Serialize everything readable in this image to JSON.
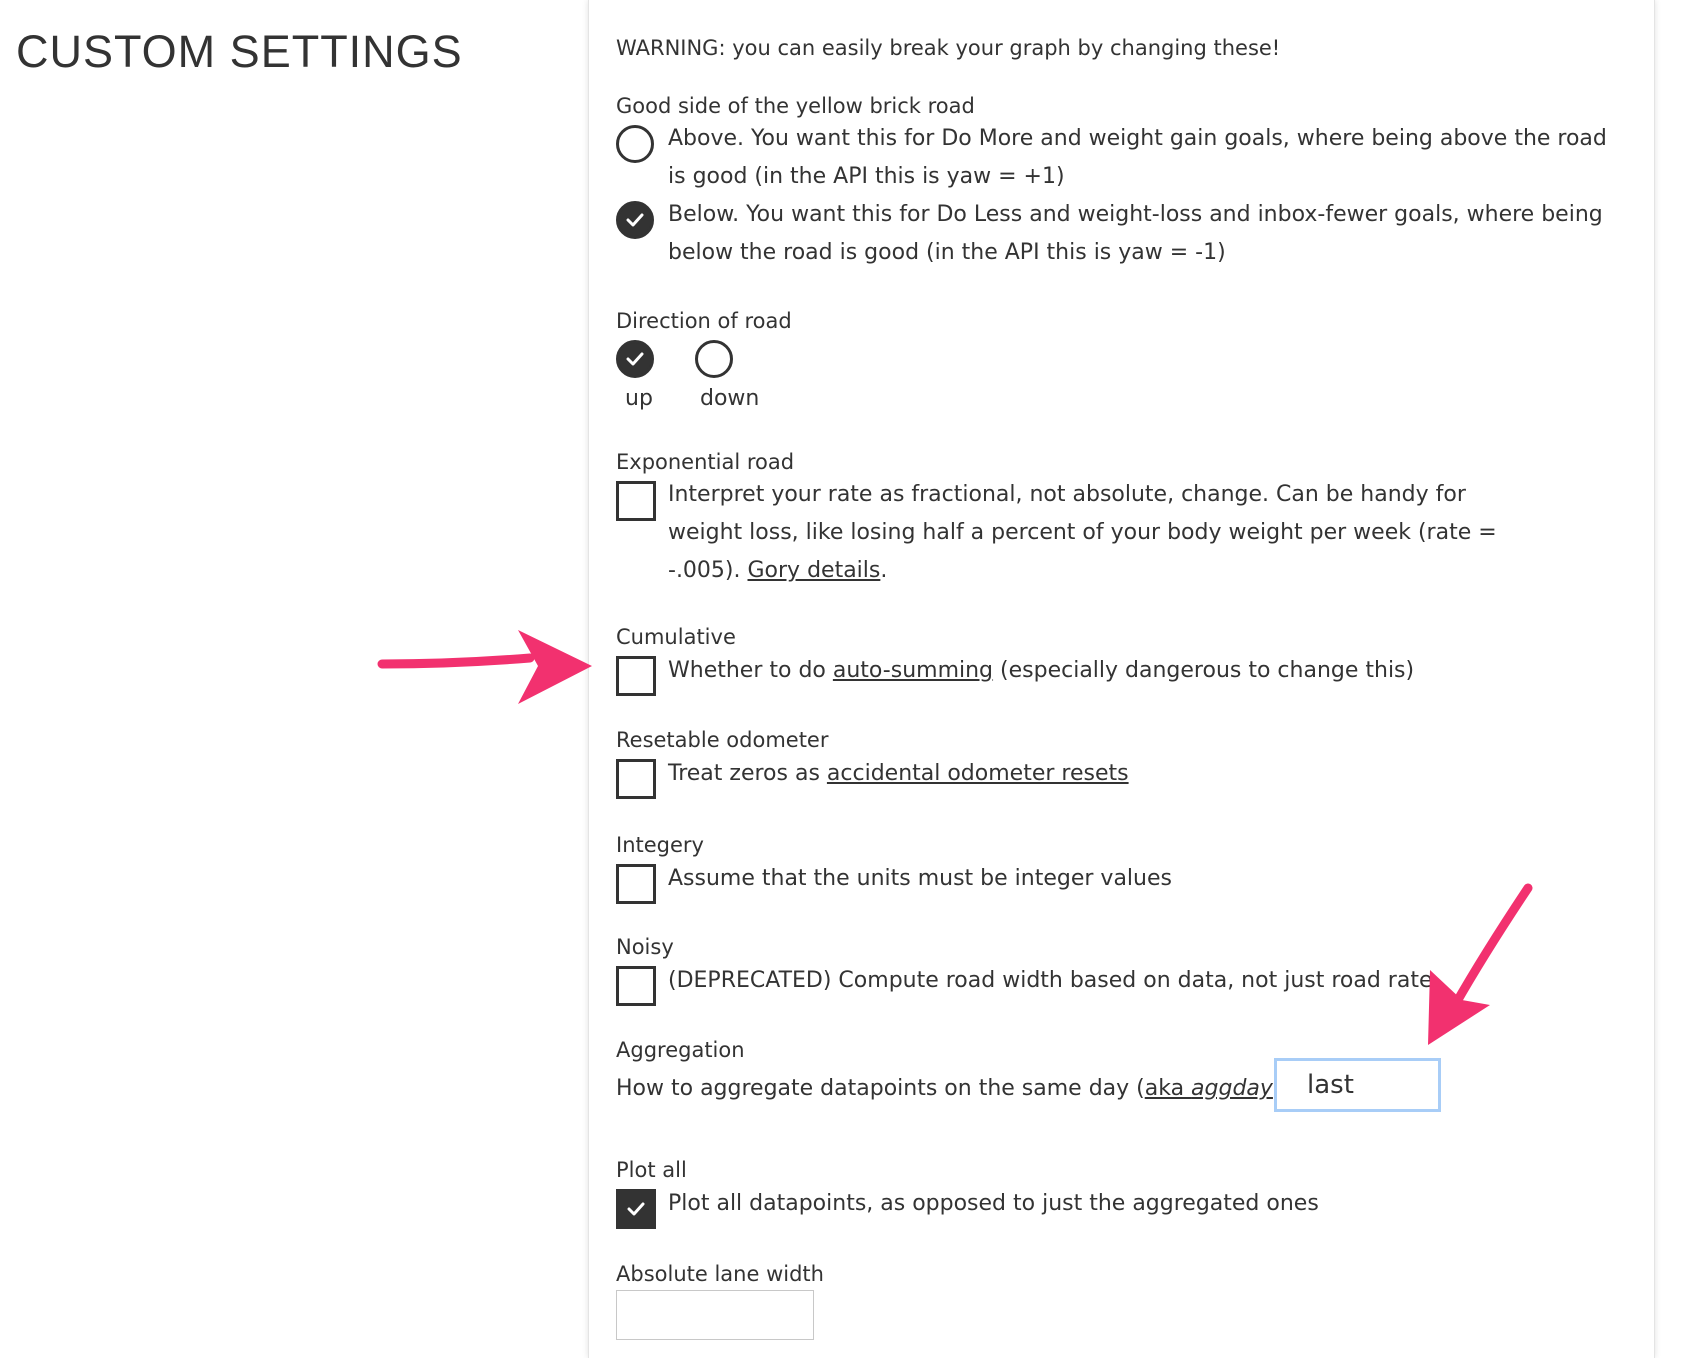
{
  "page": {
    "title": "CUSTOM SETTINGS"
  },
  "warning": "WARNING: you can easily break your graph by changing these!",
  "good_side": {
    "heading": "Good side of the yellow brick road",
    "above_text": "Above. You want this for Do More and weight gain goals, where being above the road is good (in the API this is yaw = +1)",
    "below_text": "Below. You want this for Do Less and weight-loss and inbox-fewer goals, where being below the road is good (in the API this is yaw = -1)",
    "selected": "below"
  },
  "direction": {
    "heading": "Direction of road",
    "up_label": "up",
    "down_label": "down",
    "selected": "up"
  },
  "exponential": {
    "heading": "Exponential road",
    "text_before": "Interpret your rate as fractional, not absolute, change. Can be handy for weight loss, like losing half a percent of your body weight per week (rate = -.005). ",
    "link_text": "Gory details",
    "text_after": ".",
    "checked": false
  },
  "cumulative": {
    "heading": "Cumulative",
    "text_before": "Whether to do ",
    "link_text": "auto-summing",
    "text_after": " (especially dangerous to change this)",
    "checked": false
  },
  "odometer": {
    "heading": "Resetable odometer",
    "text_before": "Treat zeros as ",
    "link_text": "accidental odometer resets",
    "checked": false
  },
  "integery": {
    "heading": "Integery",
    "text": "Assume that the units must be integer values",
    "checked": false
  },
  "noisy": {
    "heading": "Noisy",
    "text": "(DEPRECATED) Compute road width based on data, not just road rate",
    "checked": false
  },
  "aggregation": {
    "heading": "Aggregation",
    "text_before": "How to aggregate datapoints on the same day (",
    "link_plain": "aka ",
    "link_italic": "aggday",
    "text_after": ")",
    "value": "last"
  },
  "plot_all": {
    "heading": "Plot all",
    "text": "Plot all datapoints, as opposed to just the aggregated ones",
    "checked": true
  },
  "lane_width": {
    "heading": "Absolute lane width",
    "value": ""
  },
  "colors": {
    "arrow": "#f2316f",
    "text": "#333333",
    "focus_border": "#a8cdf7"
  }
}
